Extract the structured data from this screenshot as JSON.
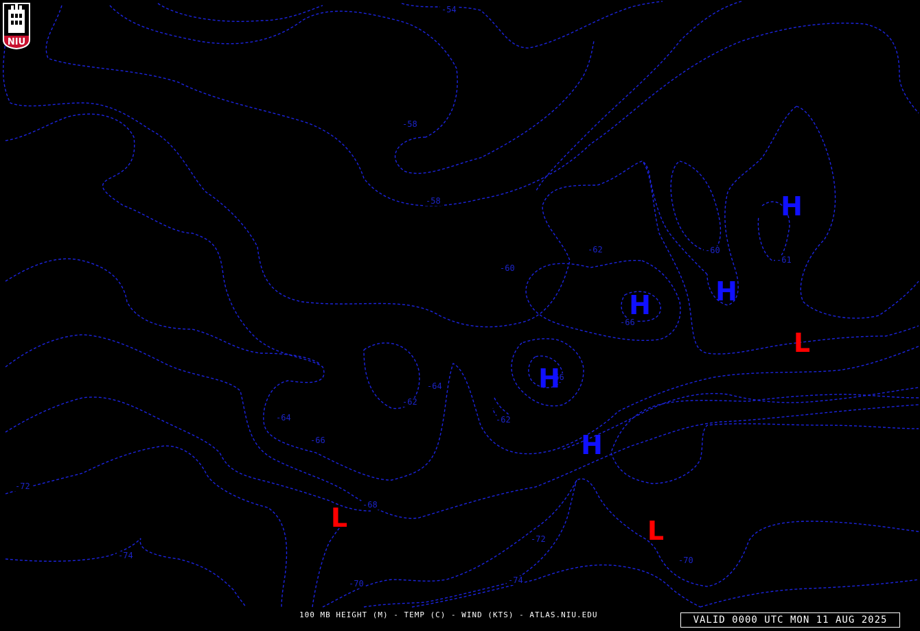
{
  "logo": {
    "text": "NIU",
    "shield_color": "#c8102e"
  },
  "footer": {
    "caption": "100 MB HEIGHT (M) - TEMP (C) - WIND (KTS) - ATLAS.NIU.EDU"
  },
  "valid_time": {
    "text": "VALID 0000 UTC MON 11 AUG 2025"
  },
  "colors": {
    "contour": "#1c24e0",
    "high": "#1010ff",
    "low": "#ff0000",
    "background": "#000000"
  },
  "contour_labels": [
    {
      "text": "-54"
    },
    {
      "text": "-58"
    },
    {
      "text": "-58"
    },
    {
      "text": "-60"
    },
    {
      "text": "-62"
    },
    {
      "text": "-60"
    },
    {
      "text": "-61"
    },
    {
      "text": "-66"
    },
    {
      "text": "-64"
    },
    {
      "text": "-62"
    },
    {
      "text": "-62"
    },
    {
      "text": "-64"
    },
    {
      "text": "-66"
    },
    {
      "text": "-66"
    },
    {
      "text": "-68"
    },
    {
      "text": "-72"
    },
    {
      "text": "-72"
    },
    {
      "text": "-74"
    },
    {
      "text": "-70"
    },
    {
      "text": "-74"
    },
    {
      "text": "-70"
    }
  ],
  "pressure_centers": [
    {
      "type": "H"
    },
    {
      "type": "H"
    },
    {
      "type": "H"
    },
    {
      "type": "H"
    },
    {
      "type": "H"
    },
    {
      "type": "L"
    },
    {
      "type": "L"
    },
    {
      "type": "L"
    }
  ]
}
